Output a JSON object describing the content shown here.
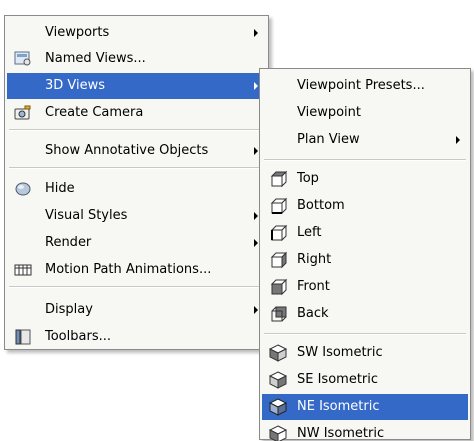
{
  "main_menu": {
    "items": [
      {
        "label": "Viewports",
        "has_submenu": true
      },
      {
        "label": "Named Views...",
        "icon": "named-views-icon"
      },
      {
        "label": "3D Views",
        "has_submenu": true,
        "highlighted": true
      },
      {
        "label": "Create Camera",
        "icon": "camera-icon"
      },
      {
        "label": "Show Annotative Objects",
        "has_submenu": true
      },
      {
        "label": "Hide",
        "icon": "hide-icon"
      },
      {
        "label": "Visual Styles",
        "has_submenu": true
      },
      {
        "label": "Render",
        "has_submenu": true
      },
      {
        "label": "Motion Path Animations...",
        "icon": "motion-path-icon"
      },
      {
        "label": "Display",
        "has_submenu": true
      },
      {
        "label": "Toolbars...",
        "icon": "toolbars-icon"
      }
    ]
  },
  "submenu_3d_views": {
    "items": [
      {
        "label": "Viewpoint Presets..."
      },
      {
        "label": "Viewpoint"
      },
      {
        "label": "Plan View",
        "has_submenu": true
      },
      {
        "label": "Top",
        "icon": "top-view-icon"
      },
      {
        "label": "Bottom",
        "icon": "bottom-view-icon"
      },
      {
        "label": "Left",
        "icon": "left-view-icon"
      },
      {
        "label": "Right",
        "icon": "right-view-icon"
      },
      {
        "label": "Front",
        "icon": "front-view-icon"
      },
      {
        "label": "Back",
        "icon": "back-view-icon"
      },
      {
        "label": "SW Isometric",
        "icon": "sw-isometric-icon"
      },
      {
        "label": "SE Isometric",
        "icon": "se-isometric-icon"
      },
      {
        "label": "NE Isometric",
        "icon": "ne-isometric-icon",
        "highlighted": true
      },
      {
        "label": "NW Isometric",
        "icon": "nw-isometric-icon"
      }
    ]
  },
  "colors": {
    "highlight": "#3569c8",
    "menu_background": "#f7f7f4",
    "menu_border": "#8a8a8a"
  }
}
